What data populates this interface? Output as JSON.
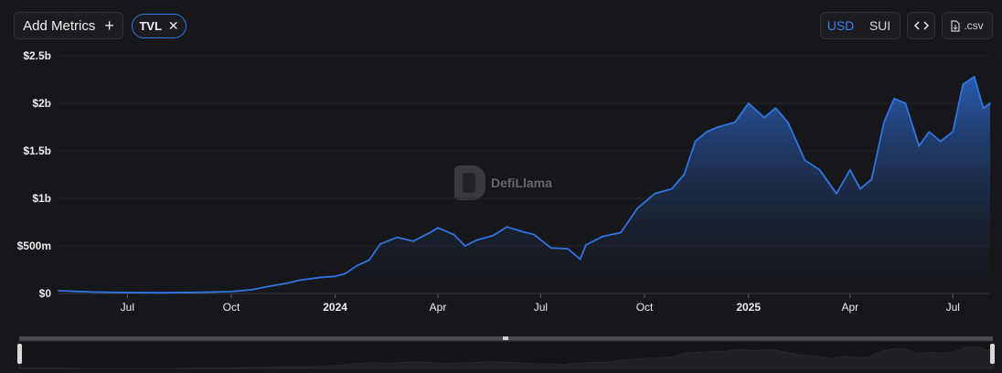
{
  "toolbar": {
    "add_metrics_label": "Add Metrics",
    "add_metrics_icon": "+",
    "chip_label": "TVL",
    "chip_close": "✕",
    "currency_options": [
      "USD",
      "SUI"
    ],
    "currency_selected": "USD",
    "embed_icon": "<>",
    "csv_label": ".csv"
  },
  "watermark": "DefiLlama",
  "colors": {
    "background": "#16171b",
    "line": "#2f74e0",
    "accent": "#3a82f0"
  },
  "chart_data": {
    "type": "area",
    "title": "",
    "xlabel": "",
    "ylabel": "",
    "y_unit": "USD",
    "ylim": [
      0,
      2500000000
    ],
    "y_ticks": [
      {
        "value": 0,
        "label": "$0"
      },
      {
        "value": 500000000,
        "label": "$500m"
      },
      {
        "value": 1000000000,
        "label": "$1b"
      },
      {
        "value": 1500000000,
        "label": "$1.5b"
      },
      {
        "value": 2000000000,
        "label": "$2b"
      },
      {
        "value": 2500000000,
        "label": "$2.5b"
      }
    ],
    "x_ticks": [
      {
        "date": "2023-07-01",
        "label": "Jul",
        "major": false
      },
      {
        "date": "2023-10-01",
        "label": "Oct",
        "major": false
      },
      {
        "date": "2024-01-01",
        "label": "2024",
        "major": true
      },
      {
        "date": "2024-04-01",
        "label": "Apr",
        "major": false
      },
      {
        "date": "2024-07-01",
        "label": "Jul",
        "major": false
      },
      {
        "date": "2024-10-01",
        "label": "Oct",
        "major": false
      },
      {
        "date": "2025-01-01",
        "label": "2025",
        "major": true
      },
      {
        "date": "2025-04-01",
        "label": "Apr",
        "major": false
      },
      {
        "date": "2025-07-01",
        "label": "Jul",
        "major": false
      }
    ],
    "xlim": [
      "2023-05-01",
      "2025-08-03"
    ],
    "grid": true,
    "series": [
      {
        "name": "TVL",
        "points": [
          [
            "2023-05-01",
            30000000
          ],
          [
            "2023-05-15",
            22000000
          ],
          [
            "2023-06-01",
            15000000
          ],
          [
            "2023-07-01",
            10000000
          ],
          [
            "2023-08-01",
            8000000
          ],
          [
            "2023-09-01",
            12000000
          ],
          [
            "2023-10-01",
            20000000
          ],
          [
            "2023-10-20",
            40000000
          ],
          [
            "2023-11-01",
            70000000
          ],
          [
            "2023-11-20",
            110000000
          ],
          [
            "2023-12-01",
            140000000
          ],
          [
            "2023-12-20",
            170000000
          ],
          [
            "2024-01-01",
            180000000
          ],
          [
            "2024-01-10",
            210000000
          ],
          [
            "2024-01-20",
            290000000
          ],
          [
            "2024-01-31",
            350000000
          ],
          [
            "2024-02-10",
            520000000
          ],
          [
            "2024-02-25",
            590000000
          ],
          [
            "2024-03-10",
            550000000
          ],
          [
            "2024-03-25",
            640000000
          ],
          [
            "2024-04-01",
            690000000
          ],
          [
            "2024-04-15",
            620000000
          ],
          [
            "2024-04-25",
            500000000
          ],
          [
            "2024-05-05",
            560000000
          ],
          [
            "2024-05-20",
            610000000
          ],
          [
            "2024-06-01",
            700000000
          ],
          [
            "2024-06-15",
            650000000
          ],
          [
            "2024-06-25",
            620000000
          ],
          [
            "2024-07-10",
            480000000
          ],
          [
            "2024-07-25",
            470000000
          ],
          [
            "2024-08-05",
            360000000
          ],
          [
            "2024-08-10",
            510000000
          ],
          [
            "2024-08-25",
            600000000
          ],
          [
            "2024-09-10",
            640000000
          ],
          [
            "2024-09-25",
            900000000
          ],
          [
            "2024-10-10",
            1050000000
          ],
          [
            "2024-10-25",
            1100000000
          ],
          [
            "2024-11-05",
            1250000000
          ],
          [
            "2024-11-15",
            1600000000
          ],
          [
            "2024-11-25",
            1700000000
          ],
          [
            "2024-12-05",
            1750000000
          ],
          [
            "2024-12-20",
            1800000000
          ],
          [
            "2025-01-01",
            2000000000
          ],
          [
            "2025-01-15",
            1850000000
          ],
          [
            "2025-01-25",
            1950000000
          ],
          [
            "2025-02-05",
            1800000000
          ],
          [
            "2025-02-20",
            1400000000
          ],
          [
            "2025-03-05",
            1300000000
          ],
          [
            "2025-03-20",
            1050000000
          ],
          [
            "2025-04-01",
            1300000000
          ],
          [
            "2025-04-10",
            1100000000
          ],
          [
            "2025-04-20",
            1200000000
          ],
          [
            "2025-05-01",
            1800000000
          ],
          [
            "2025-05-10",
            2050000000
          ],
          [
            "2025-05-20",
            2000000000
          ],
          [
            "2025-06-01",
            1550000000
          ],
          [
            "2025-06-10",
            1700000000
          ],
          [
            "2025-06-20",
            1600000000
          ],
          [
            "2025-07-01",
            1700000000
          ],
          [
            "2025-07-10",
            2200000000
          ],
          [
            "2025-07-20",
            2280000000
          ],
          [
            "2025-07-28",
            1950000000
          ],
          [
            "2025-08-03",
            2000000000
          ]
        ]
      }
    ]
  }
}
